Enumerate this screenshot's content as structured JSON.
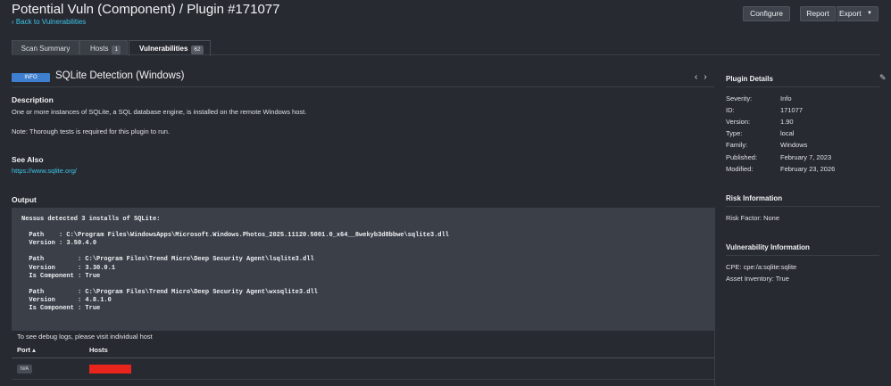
{
  "header": {
    "title": "Potential Vuln (Component) / Plugin #171077",
    "back_link": "‹ Back to Vulnerabilities",
    "buttons": {
      "configure": "Configure",
      "report": "Report",
      "export": "Export"
    }
  },
  "tabs": [
    {
      "label": "Scan Summary"
    },
    {
      "label": "Hosts",
      "count": "1"
    },
    {
      "label": "Vulnerabilities",
      "count": "62",
      "active": true
    }
  ],
  "plugin": {
    "severity_badge": "INFO",
    "severity_color": "#3f7fcf",
    "name": "SQLite Detection (Windows)"
  },
  "description": {
    "heading": "Description",
    "text": "One or more instances of SQLite, a SQL database engine, is installed on the remote Windows host.",
    "note": "Note: Thorough tests is required for this plugin to run."
  },
  "see_also": {
    "heading": "See Also",
    "link": "https://www.sqlite.org/"
  },
  "output": {
    "heading": "Output",
    "text": "Nessus detected 3 installs of SQLite:\n\n  Path    : C:\\Program Files\\WindowsApps\\Microsoft.Windows.Photos_2025.11120.5001.0_x64__8wekyb3d8bbwe\\sqlite3.dll\n  Version : 3.50.4.0\n\n  Path         : C:\\Program Files\\Trend Micro\\Deep Security Agent\\lsqlite3.dll\n  Version      : 3.30.0.1\n  Is Component : True\n\n  Path         : C:\\Program Files\\Trend Micro\\Deep Security Agent\\wxsqlite3.dll\n  Version      : 4.8.1.0\n  Is Component : True",
    "debug_text": "To see debug logs, please visit individual host",
    "columns": {
      "port": "Port ▴",
      "hosts": "Hosts"
    },
    "rows": [
      {
        "port": "N/A",
        "host": "",
        "host_redacted": true
      }
    ]
  },
  "plugin_details": {
    "heading": "Plugin Details",
    "rows": [
      {
        "label": "Severity:",
        "value": "Info"
      },
      {
        "label": "ID:",
        "value": "171077"
      },
      {
        "label": "Version:",
        "value": "1.90"
      },
      {
        "label": "Type:",
        "value": "local"
      },
      {
        "label": "Family:",
        "value": "Windows"
      },
      {
        "label": "Published:",
        "value": "February 7, 2023"
      },
      {
        "label": "Modified:",
        "value": "February 23, 2026"
      }
    ]
  },
  "risk_information": {
    "heading": "Risk Information",
    "risk_factor": "Risk Factor: None"
  },
  "vulnerability_information": {
    "heading": "Vulnerability Information",
    "cpe": "CPE: cpe:/a:sqlite:sqlite",
    "asset_inventory": "Asset Inventory: True"
  },
  "colors": {
    "background": "#272a31",
    "link": "#3ec3e6",
    "redaction": "#e8251c"
  }
}
